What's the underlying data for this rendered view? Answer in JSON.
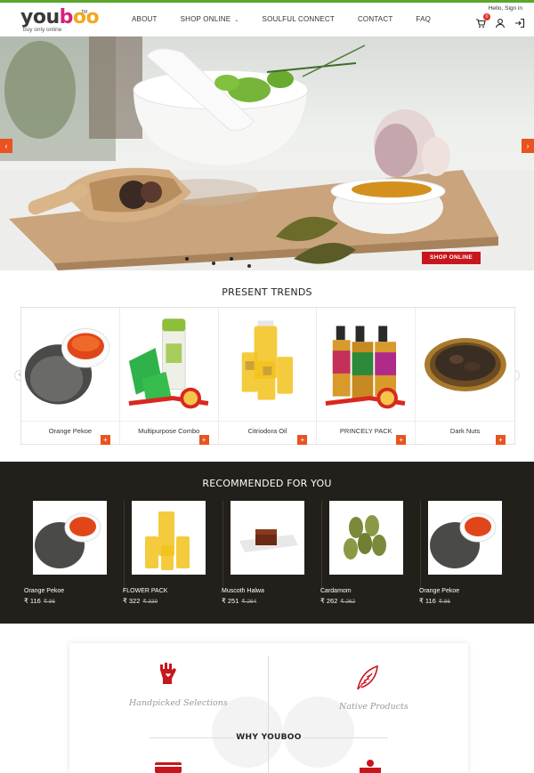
{
  "brand": {
    "logo_text": "youboo",
    "logo_tm": "TM",
    "tagline": "buy only online"
  },
  "nav": {
    "items": [
      {
        "label": "ABOUT"
      },
      {
        "label": "SHOP ONLINE"
      },
      {
        "label": "SOULFUL CONNECT"
      },
      {
        "label": "CONTACT"
      },
      {
        "label": "FAQ"
      }
    ]
  },
  "account": {
    "greeting": "Hello, Sign in",
    "cart_count": "0"
  },
  "icons": {
    "cart": "cart-icon",
    "user": "user-icon",
    "login": "login-icon",
    "prev": "chevron-left-icon",
    "next": "chevron-right-icon"
  },
  "hero": {
    "cta_label": "SHOP ONLINE"
  },
  "trends": {
    "title": "PRESENT TRENDS",
    "items": [
      {
        "name": "Orange Pekoe"
      },
      {
        "name": "Multipurpose Combo",
        "badge": "COMBO"
      },
      {
        "name": "Citriodora Oil"
      },
      {
        "name": "PRINCELY PACK",
        "badge": "COMBO"
      },
      {
        "name": "Dark Nuts"
      }
    ],
    "add_label": "+"
  },
  "recommended": {
    "title": "RECOMMENDED FOR YOU",
    "items": [
      {
        "name": "Orange Pekoe",
        "price": "₹ 116",
        "old_price": "₹ 86"
      },
      {
        "name": "FLOWER PACK",
        "price": "₹ 322",
        "old_price": "₹ 339"
      },
      {
        "name": "Muscoth Halwa",
        "price": "₹ 251",
        "old_price": "₹ 264"
      },
      {
        "name": "Cardamom",
        "price": "₹ 262",
        "old_price": "₹ 262"
      },
      {
        "name": "Orange Pekoe",
        "price": "₹ 116",
        "old_price": "₹ 86"
      }
    ]
  },
  "why": {
    "title": "WHY YOUBOO",
    "features": [
      {
        "label": "Handpicked Selections"
      },
      {
        "label": "Native Products"
      }
    ]
  },
  "colors": {
    "accent_green": "#5aa72c",
    "orange": "#e8531f",
    "red": "#c8161d",
    "dark_band": "#231f1a"
  }
}
